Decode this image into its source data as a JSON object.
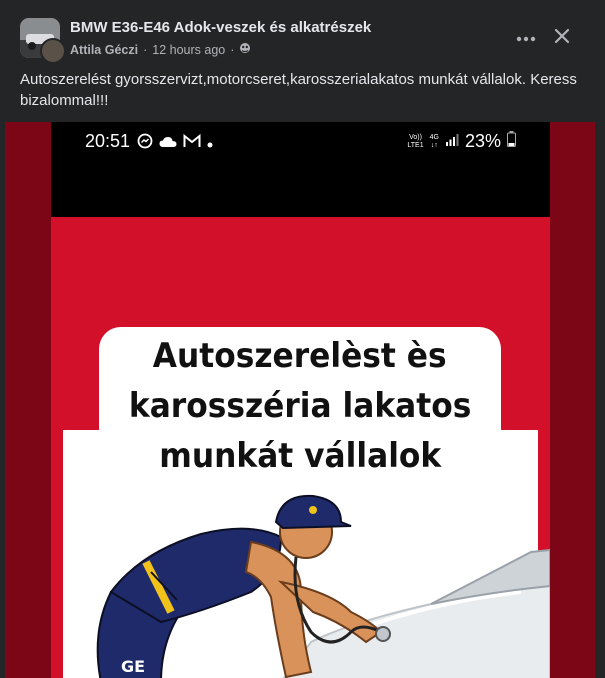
{
  "post": {
    "group_name": "BMW E36-E46 Adok-veszek és alkatrészek",
    "author": "Attila Géczi",
    "separator": "·",
    "time": "12 hours ago",
    "separator2": "·",
    "audience_icon": "group-audience-icon",
    "text": "Autoszerelést gyorsszervizt,motorcseret,karosszerialakatos munkát vállalok. Keress bizalommal!!!"
  },
  "header_actions": {
    "more_icon": "more-horizontal-icon",
    "close_icon": "close-icon"
  },
  "image": {
    "status_time": "20:51",
    "status_battery": "23%",
    "status_network_top": "Vo))",
    "status_network_bottom": "LTE1",
    "status_4g": "4G",
    "notification_icons": [
      "messenger-icon",
      "cloud-icon",
      "gmail-icon",
      "dot-icon"
    ],
    "title_lines": [
      "Autoszerelèst ès",
      "karosszéria lakatos",
      "munkát vállalok"
    ],
    "colors": {
      "red": "#d3102a",
      "dark_red": "#7d0616",
      "navy": "#1f2a6b"
    }
  }
}
